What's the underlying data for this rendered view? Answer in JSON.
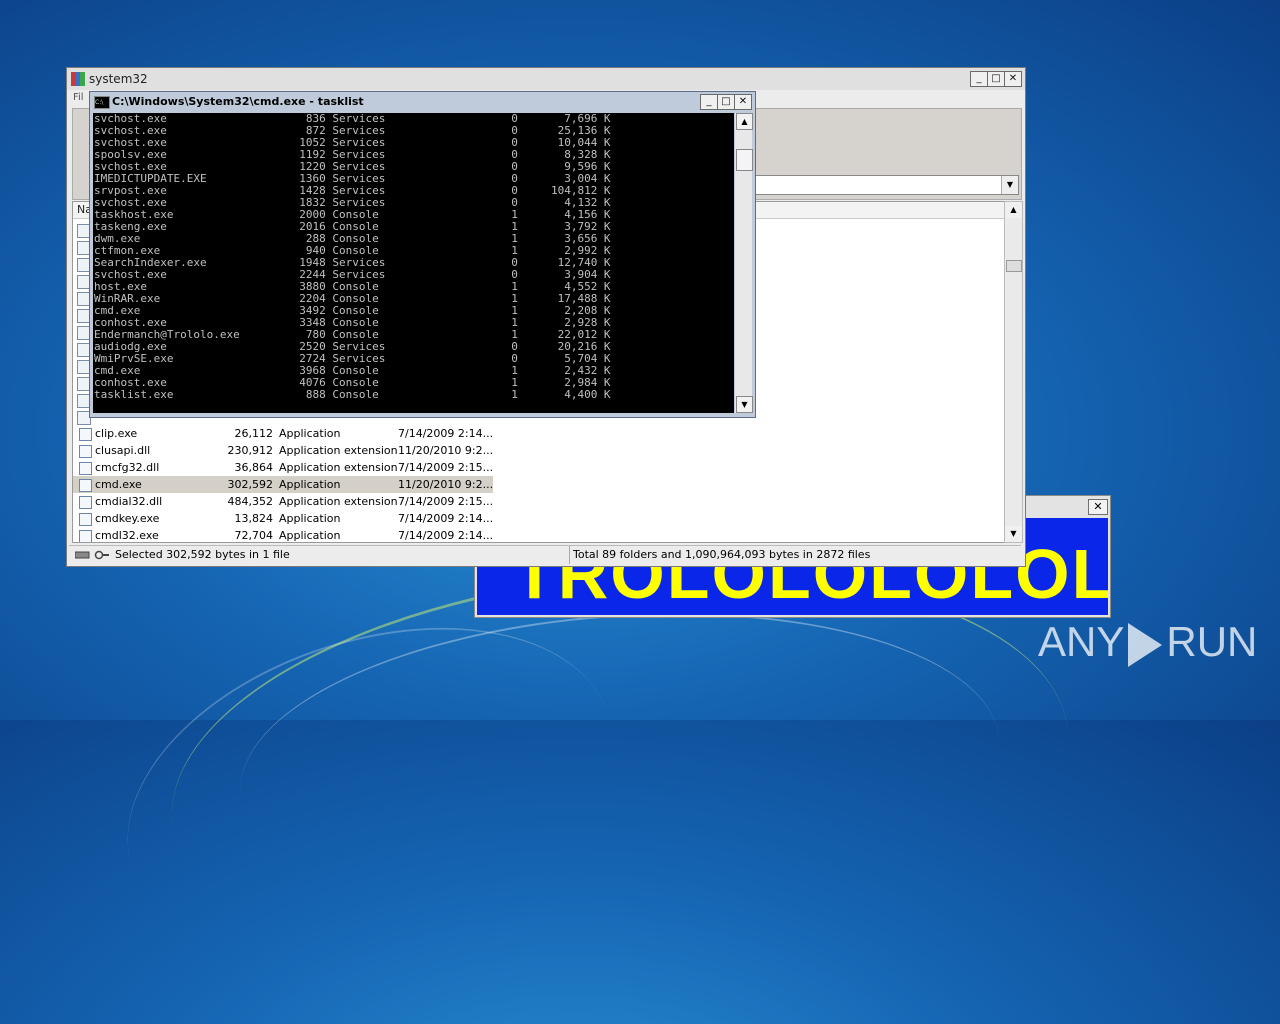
{
  "trololo_window": {
    "text": "TROLOLOLOLOL",
    "close": "✕"
  },
  "winrar": {
    "title": "system32",
    "menu_first": "Fil",
    "column_header": "Na",
    "minimize": "_",
    "maximize": "□",
    "close": "✕",
    "files": [
      {
        "name": "clip.exe",
        "size": "26,112",
        "type": "Application",
        "date": "7/14/2009 2:14..."
      },
      {
        "name": "clusapi.dll",
        "size": "230,912",
        "type": "Application extension",
        "date": "11/20/2010 9:2..."
      },
      {
        "name": "cmcfg32.dll",
        "size": "36,864",
        "type": "Application extension",
        "date": "7/14/2009 2:15..."
      },
      {
        "name": "cmd.exe",
        "size": "302,592",
        "type": "Application",
        "date": "11/20/2010 9:2..."
      },
      {
        "name": "cmdial32.dll",
        "size": "484,352",
        "type": "Application extension",
        "date": "7/14/2009 2:15..."
      },
      {
        "name": "cmdkey.exe",
        "size": "13,824",
        "type": "Application",
        "date": "7/14/2009 2:14..."
      },
      {
        "name": "cmdl32.exe",
        "size": "72,704",
        "type": "Application",
        "date": "7/14/2009 2:14..."
      }
    ],
    "status_left": "Selected 302,592 bytes in 1 file",
    "status_right": "Total 89 folders and 1,090,964,093 bytes in 2872 files"
  },
  "cmd": {
    "title": "C:\\Windows\\System32\\cmd.exe - tasklist",
    "processes": [
      {
        "name": "svchost.exe",
        "pid": "836",
        "session": "Services",
        "num": "0",
        "mem": "7,696 K"
      },
      {
        "name": "svchost.exe",
        "pid": "872",
        "session": "Services",
        "num": "0",
        "mem": "25,136 K"
      },
      {
        "name": "svchost.exe",
        "pid": "1052",
        "session": "Services",
        "num": "0",
        "mem": "10,044 K"
      },
      {
        "name": "spoolsv.exe",
        "pid": "1192",
        "session": "Services",
        "num": "0",
        "mem": "8,328 K"
      },
      {
        "name": "svchost.exe",
        "pid": "1220",
        "session": "Services",
        "num": "0",
        "mem": "9,596 K"
      },
      {
        "name": "IMEDICTUPDATE.EXE",
        "pid": "1360",
        "session": "Services",
        "num": "0",
        "mem": "3,004 K"
      },
      {
        "name": "srvpost.exe",
        "pid": "1428",
        "session": "Services",
        "num": "0",
        "mem": "104,812 K"
      },
      {
        "name": "svchost.exe",
        "pid": "1832",
        "session": "Services",
        "num": "0",
        "mem": "4,132 K"
      },
      {
        "name": "taskhost.exe",
        "pid": "2000",
        "session": "Console",
        "num": "1",
        "mem": "4,156 K"
      },
      {
        "name": "taskeng.exe",
        "pid": "2016",
        "session": "Console",
        "num": "1",
        "mem": "3,792 K"
      },
      {
        "name": "dwm.exe",
        "pid": "288",
        "session": "Console",
        "num": "1",
        "mem": "3,656 K"
      },
      {
        "name": "ctfmon.exe",
        "pid": "940",
        "session": "Console",
        "num": "1",
        "mem": "2,992 K"
      },
      {
        "name": "SearchIndexer.exe",
        "pid": "1948",
        "session": "Services",
        "num": "0",
        "mem": "12,740 K"
      },
      {
        "name": "svchost.exe",
        "pid": "2244",
        "session": "Services",
        "num": "0",
        "mem": "3,904 K"
      },
      {
        "name": "host.exe",
        "pid": "3880",
        "session": "Console",
        "num": "1",
        "mem": "4,552 K"
      },
      {
        "name": "WinRAR.exe",
        "pid": "2204",
        "session": "Console",
        "num": "1",
        "mem": "17,488 K"
      },
      {
        "name": "cmd.exe",
        "pid": "3492",
        "session": "Console",
        "num": "1",
        "mem": "2,208 K"
      },
      {
        "name": "conhost.exe",
        "pid": "3348",
        "session": "Console",
        "num": "1",
        "mem": "2,928 K"
      },
      {
        "name": "Endermanch@Trololo.exe",
        "pid": "780",
        "session": "Console",
        "num": "1",
        "mem": "22,012 K"
      },
      {
        "name": "audiodg.exe",
        "pid": "2520",
        "session": "Services",
        "num": "0",
        "mem": "20,216 K"
      },
      {
        "name": "WmiPrvSE.exe",
        "pid": "2724",
        "session": "Services",
        "num": "0",
        "mem": "5,704 K"
      },
      {
        "name": "cmd.exe",
        "pid": "3968",
        "session": "Console",
        "num": "1",
        "mem": "2,432 K"
      },
      {
        "name": "conhost.exe",
        "pid": "4076",
        "session": "Console",
        "num": "1",
        "mem": "2,984 K"
      },
      {
        "name": "tasklist.exe",
        "pid": "888",
        "session": "Console",
        "num": "1",
        "mem": "4,400 K"
      }
    ]
  },
  "watermark": {
    "left": "ANY",
    "right": "RUN"
  }
}
